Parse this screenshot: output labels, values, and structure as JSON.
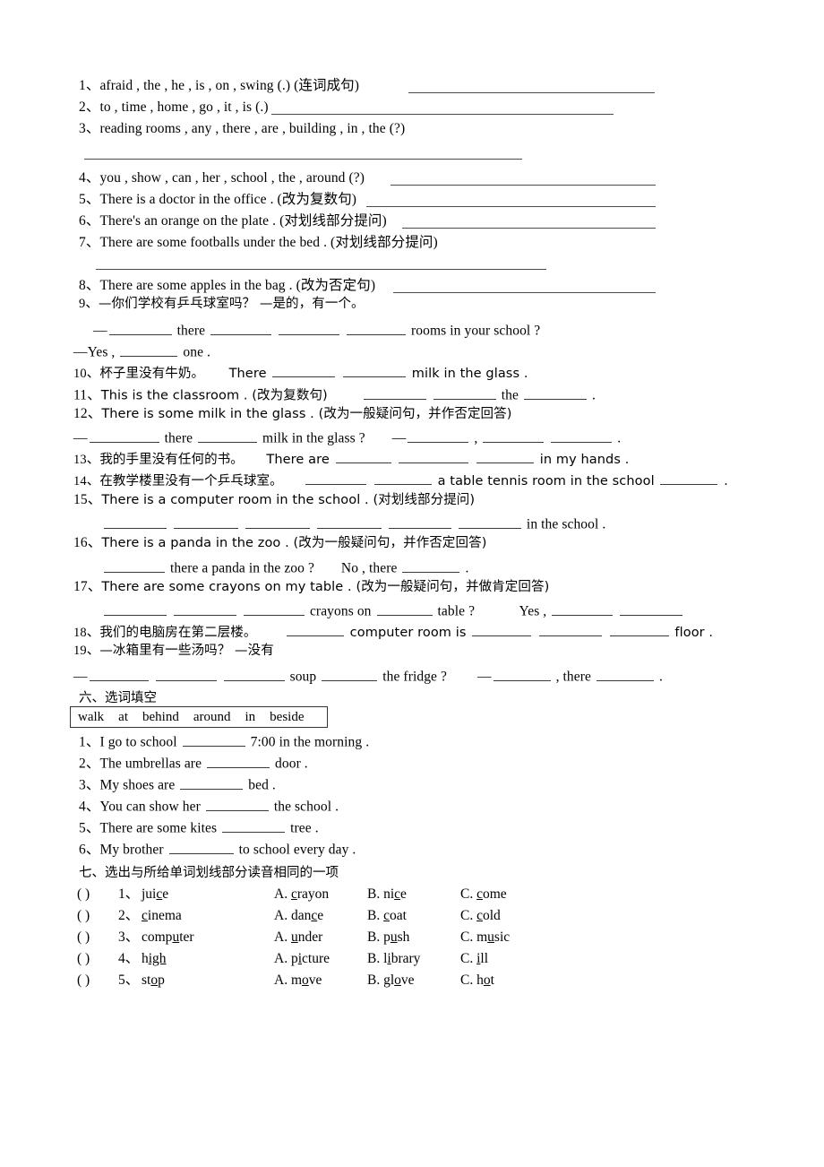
{
  "document": {
    "type": "english-worksheet",
    "language": "en-zh"
  },
  "rewrite_items": [
    {
      "num": "1、",
      "text": "afraid , the , he , is , on , swing (.) (连词成句)",
      "trailing_rule": true
    },
    {
      "num": "2、",
      "text": "to , time , home , go , it , is (.)",
      "trailing_rule": true
    },
    {
      "num": "3、",
      "text": "reading rooms , any , there , are , building , in , the (?)",
      "trailing_rule": false
    },
    {
      "num": "4、",
      "text": "you , show , can , her , school , the , around (?)",
      "trailing_rule": true
    },
    {
      "num": "5、",
      "text": "There is a doctor in the office . (改为复数句)",
      "trailing_rule": true
    },
    {
      "num": "6、",
      "text": "There's an orange on the plate . (对划线部分提问)",
      "trailing_rule": true
    },
    {
      "num": "7、",
      "text": "There are some footballs under the bed . (对划线部分提问)",
      "trailing_rule": false
    },
    {
      "num": "8、",
      "text": "There are some apples in the bag . (改为否定句)",
      "trailing_rule": true
    },
    {
      "num": "9、",
      "text": "—你们学校有乒乓球室吗？     —是的，有一个。"
    },
    {
      "num": "10、",
      "text": "杯子里没有牛奶。"
    },
    {
      "num": "11、",
      "text": "This is the classroom . (改为复数句)"
    },
    {
      "num": "12、",
      "text": "There is some milk in the glass . (改为一般疑问句，并作否定回答)"
    },
    {
      "num": "13、",
      "text": "我的手里没有任何的书。"
    },
    {
      "num": "14、",
      "text": "在教学楼里没有一个乒乓球室。"
    },
    {
      "num": "15、",
      "text": "There is a computer room in the school . (对划线部分提问)"
    },
    {
      "num": "16、",
      "text": "There is a panda in the zoo . (改为一般疑问句，并作否定回答)"
    },
    {
      "num": "17、",
      "text": "There are some crayons on my table . (改为一般疑问句，并做肯定回答)"
    },
    {
      "num": "18、",
      "text": "我们的电脑房在第二层楼。"
    },
    {
      "num": "19、",
      "text": "—冰箱里有一些汤吗？ —没有"
    }
  ],
  "answer_lines": {
    "q9a_there": "there",
    "q9a_tail": "rooms in your school ?",
    "q9b_yes": "—Yes ,",
    "q9b_one": "one .",
    "q10_there": "There",
    "q10_tail": "milk in the glass .",
    "q11_the": "the",
    "q11_dot": ".",
    "q12_dash": "—",
    "q12_there": "there",
    "q12_mid": "milk in the glass ?",
    "q12_dash2": "—",
    "q12_comma": ",",
    "q12_dot": ".",
    "q13_there_are": "There are",
    "q13_tail": "in my hands .",
    "q14_tail": "a table tennis room in the school",
    "q14_dot": ".",
    "q15_tail": "in the school .",
    "q16_there": "there a panda in the zoo ?",
    "q16_no": "No , there",
    "q16_dot": ".",
    "q17_crayons": "crayons on",
    "q17_table": "table ?",
    "q17_yes": "Yes ,",
    "q18_computer": "computer room is",
    "q18_floor": "floor .",
    "q19_dash": "—",
    "q19_soup": "soup",
    "q19_fridge": "the fridge ?",
    "q19_dash2": "—",
    "q19_comma": ", there",
    "q19_dot": "."
  },
  "section_six": {
    "heading": "六、选词填空",
    "word_bank": [
      "walk",
      "at",
      "behind",
      "around",
      "in",
      "beside"
    ],
    "items": [
      {
        "num": "1、",
        "before": "I go to school",
        "after": "7:00 in the morning ."
      },
      {
        "num": "2、",
        "before": "The umbrellas are",
        "after": "door ."
      },
      {
        "num": "3、",
        "before": "My shoes are",
        "after": "bed ."
      },
      {
        "num": "4、",
        "before": "You can show her",
        "after": "the school ."
      },
      {
        "num": "5、",
        "before": "There are some kites",
        "after": "tree ."
      },
      {
        "num": "6、",
        "before": "My brother",
        "after": "to school every day ."
      }
    ]
  },
  "section_seven": {
    "heading": "七、选出与所给单词划线部分读音相同的一项",
    "rows": [
      {
        "paren": "(          )",
        "num": "1、",
        "word": {
          "pre": "jui",
          "u": "c",
          "post": "e"
        },
        "options": [
          {
            "label": "A. ",
            "pre": "",
            "u": "c",
            "post": "rayon"
          },
          {
            "label": "B. ",
            "pre": "ni",
            "u": "c",
            "post": "e"
          },
          {
            "label": "C. ",
            "pre": "",
            "u": "c",
            "post": "ome"
          }
        ]
      },
      {
        "paren": "(          )",
        "num": "2、",
        "word": {
          "pre": "",
          "u": "c",
          "post": "inema"
        },
        "options": [
          {
            "label": "A. ",
            "pre": "dan",
            "u": "c",
            "post": "e"
          },
          {
            "label": "B. ",
            "pre": "",
            "u": "c",
            "post": "oat"
          },
          {
            "label": "C. ",
            "pre": "",
            "u": "c",
            "post": "old"
          }
        ]
      },
      {
        "paren": "(          )",
        "num": "3、",
        "word": {
          "pre": "comp",
          "u": "u",
          "post": "ter"
        },
        "options": [
          {
            "label": "A. ",
            "pre": "",
            "u": "u",
            "post": "nder"
          },
          {
            "label": "B. ",
            "pre": "p",
            "u": "u",
            "post": "sh"
          },
          {
            "label": "C. ",
            "pre": "m",
            "u": "u",
            "post": "sic"
          }
        ]
      },
      {
        "paren": "(          )",
        "num": "4、",
        "word": {
          "pre": "h",
          "u": "igh",
          "post": ""
        },
        "options": [
          {
            "label": "A. ",
            "pre": "p",
            "u": "i",
            "post": "cture"
          },
          {
            "label": "B. ",
            "pre": "l",
            "u": "i",
            "post": "brary"
          },
          {
            "label": "C. ",
            "pre": "",
            "u": "i",
            "post": "ll"
          }
        ]
      },
      {
        "paren": "(          )",
        "num": "5、",
        "word": {
          "pre": "st",
          "u": "o",
          "post": "p"
        },
        "options": [
          {
            "label": "A. ",
            "pre": "m",
            "u": "o",
            "post": "ve"
          },
          {
            "label": "B. ",
            "pre": "gl",
            "u": "o",
            "post": "ve"
          },
          {
            "label": "C. ",
            "pre": "h",
            "u": "o",
            "post": "t"
          }
        ]
      }
    ]
  }
}
